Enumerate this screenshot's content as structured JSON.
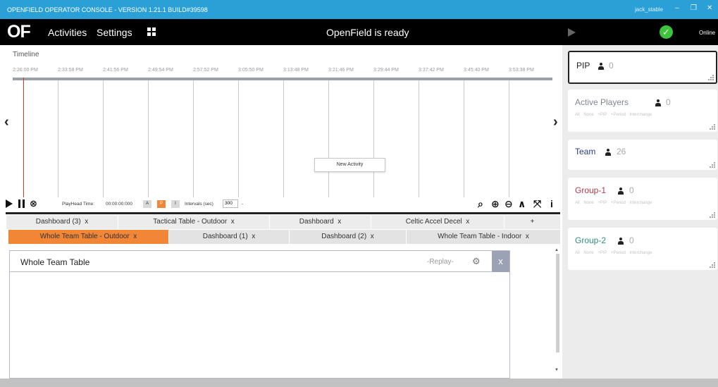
{
  "window": {
    "title": "OPENFIELD OPERATOR CONSOLE - VERSION 1.21.1 BUILD#39598",
    "user": "jack_stable",
    "controls": [
      "–",
      "❐",
      "✕"
    ]
  },
  "menubar": {
    "logo": "OF",
    "items": [
      "Activities",
      "Settings"
    ],
    "grid_icon": "grid-icon",
    "status": "OpenField is ready",
    "connection": "Online"
  },
  "timeline": {
    "label": "Timeline",
    "ticks": [
      "2:26:00 PM",
      "2:33:58 PM",
      "2:41:56 PM",
      "2:49:54 PM",
      "2:57:52 PM",
      "3:05:50 PM",
      "3:13:48 PM",
      "3:21:46 PM",
      "3:29:44 PM",
      "3:37:42 PM",
      "3:45:40 PM",
      "3:53:38 PM"
    ],
    "context_menu": "New Activity",
    "prev": "‹",
    "next": "›"
  },
  "controls": {
    "playhead_label": "PlayHead Time:",
    "playhead_time": "00:00:00:000",
    "mode_a": "A",
    "mode_p": "P",
    "mode_i": "I",
    "intervals_label": "Intervals (sec)",
    "intervals_value": "300",
    "intervals_dash": "-",
    "tools": [
      "⌕",
      "⊕",
      "⊖",
      "∧",
      "⤧",
      "i"
    ]
  },
  "tabs": {
    "row1": [
      {
        "label": "Dashboard (3)",
        "close": "x"
      },
      {
        "label": "Tactical Table - Outdoor",
        "close": "x"
      },
      {
        "label": "Dashboard",
        "close": "x"
      },
      {
        "label": "Celtic Accel Decel",
        "close": "x"
      },
      {
        "label": "+",
        "close": ""
      }
    ],
    "row2": [
      {
        "label": "Whole Team Table - Outdoor",
        "close": "x",
        "active": true
      },
      {
        "label": "Dashboard (1)",
        "close": "x"
      },
      {
        "label": "Dashboard (2)",
        "close": "x"
      },
      {
        "label": "Whole Team Table - Indoor",
        "close": "x"
      }
    ]
  },
  "panel": {
    "title": "Whole Team Table",
    "replay": "-Replay-",
    "close": "x"
  },
  "sidebar": {
    "cards": [
      {
        "title": "PIP",
        "count": "0",
        "title_color": "#222222",
        "filters": ""
      },
      {
        "title": "Active Players",
        "count": "0",
        "title_color": "#7f8590",
        "filters": "All None +PIP +Period Interchange"
      },
      {
        "title": "Team",
        "count": "26",
        "title_color": "#2b3a8c",
        "filters": ""
      },
      {
        "title": "Group-1",
        "count": "0",
        "title_color": "#b23a48",
        "filters": "All None +PIP +Period Interchange"
      },
      {
        "title": "Group-2",
        "count": "0",
        "title_color": "#2f8f79",
        "filters": "All None +PIP +Period Interchange"
      }
    ]
  },
  "colors": {
    "titlebar": "#2aa0d6",
    "menubar": "#000000",
    "accent_orange": "#f08636",
    "playhead": "#e23333",
    "ok_green": "#3dc43d"
  }
}
